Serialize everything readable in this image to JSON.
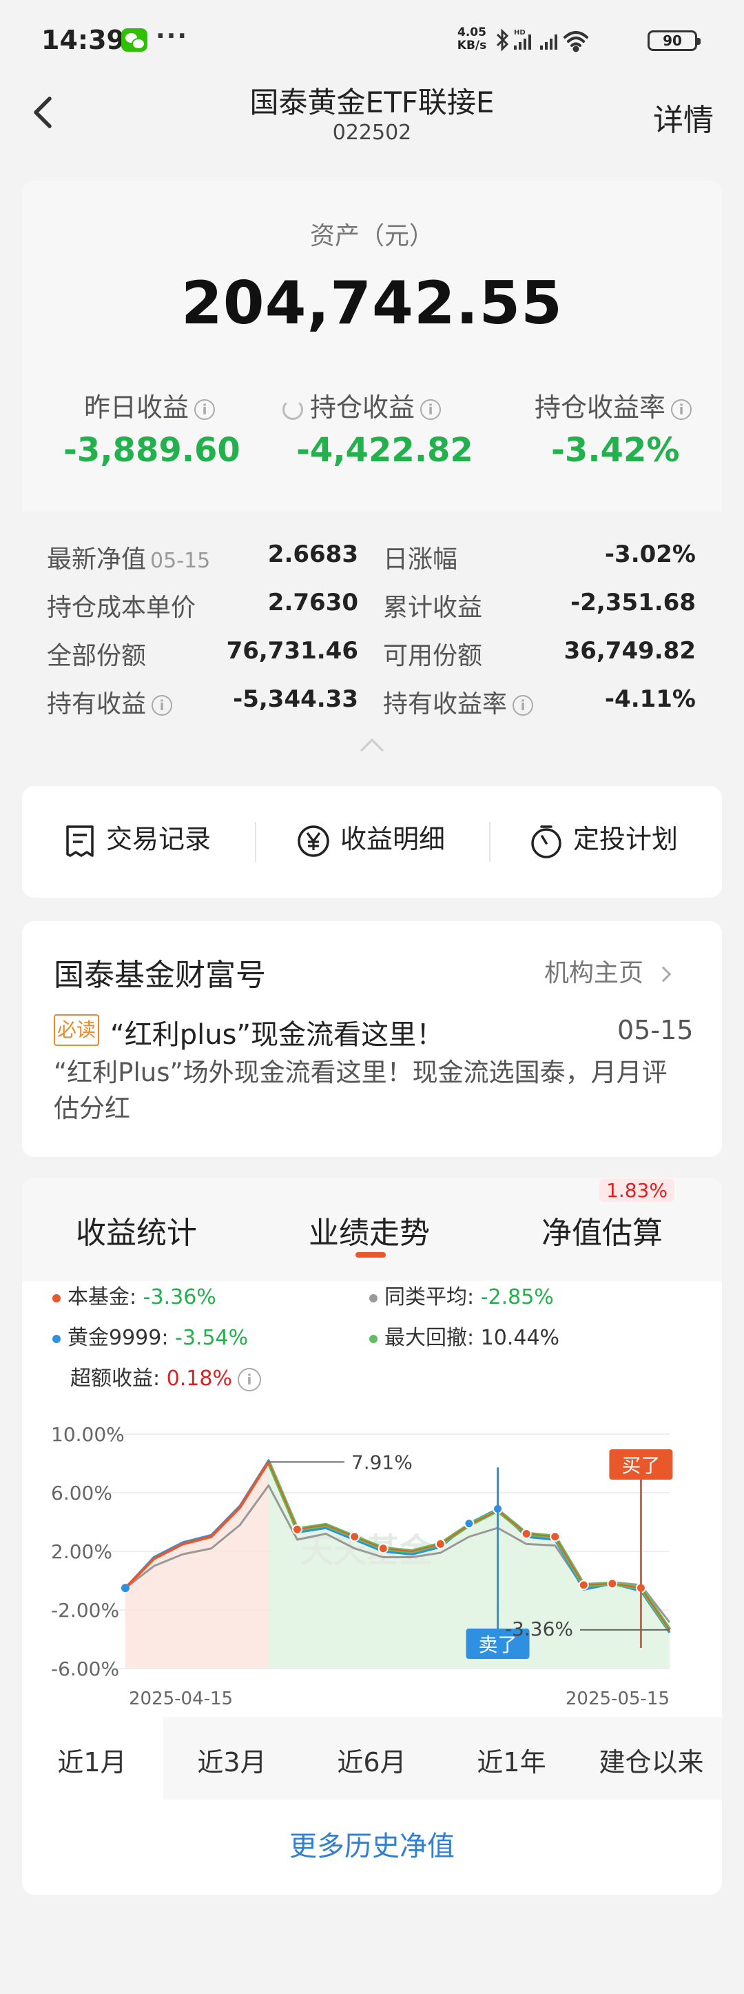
{
  "status_bar": {
    "time": "14:39",
    "more": "···",
    "net_speed_value": "4.05",
    "net_speed_unit": "KB/s",
    "battery": "90",
    "icons": [
      "wechat-icon",
      "bluetooth-icon",
      "hd-signal-icon",
      "signal-icon",
      "wifi-icon",
      "battery-icon"
    ]
  },
  "header": {
    "title": "国泰黄金ETF联接E",
    "code": "022502",
    "detail_label": "详情"
  },
  "asset": {
    "label": "资产（元）",
    "value": "204,742.55",
    "metrics": [
      {
        "label": "昨日收益",
        "value": "-3,889.60"
      },
      {
        "label": "持仓收益",
        "value": "-4,422.82"
      },
      {
        "label": "持仓收益率",
        "value": "-3.42%"
      }
    ]
  },
  "details": {
    "left": [
      {
        "label": "最新净值",
        "sub": "05-15",
        "value": "2.6683"
      },
      {
        "label": "持仓成本单价",
        "value": "2.7630"
      },
      {
        "label": "全部份额",
        "value": "76,731.46"
      },
      {
        "label": "持有收益",
        "value": "-5,344.33"
      }
    ],
    "right": [
      {
        "label": "日涨幅",
        "value": "-3.02%"
      },
      {
        "label": "累计收益",
        "value": "-2,351.68"
      },
      {
        "label": "可用份额",
        "value": "36,749.82"
      },
      {
        "label": "持有收益率",
        "value": "-4.11%"
      }
    ]
  },
  "actions": [
    {
      "label": "交易记录",
      "icon": "receipt-icon"
    },
    {
      "label": "收益明细",
      "icon": "yen-icon"
    },
    {
      "label": "定投计划",
      "icon": "timer-icon"
    }
  ],
  "wealth": {
    "title": "国泰基金财富号",
    "link": "机构主页",
    "badge": "必读",
    "headline": "“红利plus”现金流看这里！",
    "date": "05-15",
    "summary": "“红利Plus”场外现金流看这里！现金流选国泰，月月评估分红"
  },
  "perf_tabs": {
    "items": [
      "收益统计",
      "业绩走势",
      "净值估算"
    ],
    "active": "业绩走势",
    "estimate_badge": "1.83%"
  },
  "legend": {
    "fund_label": "本基金: ",
    "fund_value": "-3.36%",
    "peer_label": "同类平均: ",
    "peer_value": "-2.85%",
    "gold_label": "黄金9999: ",
    "gold_value": "-3.54%",
    "drawdown_label": "最大回撤: ",
    "drawdown_value": "10.44%",
    "excess_label": "超额收益: ",
    "excess_value": "0.18%"
  },
  "chart_data": {
    "type": "line",
    "x_start": "2025-04-15",
    "x_end": "2025-05-15",
    "y_ticks": [
      "10.00%",
      "6.00%",
      "2.00%",
      "-2.00%",
      "-6.00%"
    ],
    "ylim": [
      -6,
      10
    ],
    "watermark": "天天基金",
    "peak_label": "7.91%",
    "end_label": "-3.36%",
    "buy_label": "买了",
    "sell_label": "卖了",
    "colors": {
      "fund": "#e9582a",
      "peer": "#999999",
      "gold": "#2f8fe0",
      "drawdown": "#5cc15c"
    },
    "series": [
      {
        "name": "本基金",
        "values": [
          -0.5,
          1.5,
          2.5,
          3.0,
          5.0,
          8.1,
          3.5,
          3.8,
          3.0,
          2.2,
          2.0,
          2.5,
          3.8,
          4.8,
          3.2,
          3.0,
          -0.3,
          -0.2,
          -0.5,
          -3.36
        ]
      },
      {
        "name": "同类平均",
        "values": [
          -0.5,
          1.0,
          1.8,
          2.2,
          3.8,
          6.5,
          2.8,
          3.2,
          2.2,
          1.6,
          1.6,
          1.9,
          3.0,
          3.6,
          2.5,
          2.4,
          -0.5,
          -0.1,
          -0.3,
          -2.85
        ]
      },
      {
        "name": "黄金9999",
        "values": [
          -0.5,
          1.6,
          2.6,
          3.1,
          5.1,
          8.2,
          3.3,
          3.6,
          2.8,
          2.0,
          1.8,
          2.3,
          3.9,
          4.9,
          3.0,
          2.8,
          -0.6,
          -0.2,
          -0.7,
          -3.54
        ]
      }
    ],
    "highlight_points": [
      {
        "index": 6,
        "series": "本基金"
      },
      {
        "index": 8,
        "series": "本基金"
      },
      {
        "index": 9,
        "series": "本基金"
      },
      {
        "index": 11,
        "series": "本基金"
      },
      {
        "index": 12,
        "series": "黄金9999"
      },
      {
        "index": 13,
        "series": "黄金9999"
      },
      {
        "index": 14,
        "series": "本基金"
      },
      {
        "index": 15,
        "series": "本基金"
      },
      {
        "index": 16,
        "series": "本基金"
      },
      {
        "index": 17,
        "series": "本基金"
      },
      {
        "index": 18,
        "series": "本基金"
      }
    ]
  },
  "ranges": {
    "items": [
      "近1月",
      "近3月",
      "近6月",
      "近1年",
      "建仓以来"
    ],
    "active": "近1月"
  },
  "more_history": "更多历史净值"
}
